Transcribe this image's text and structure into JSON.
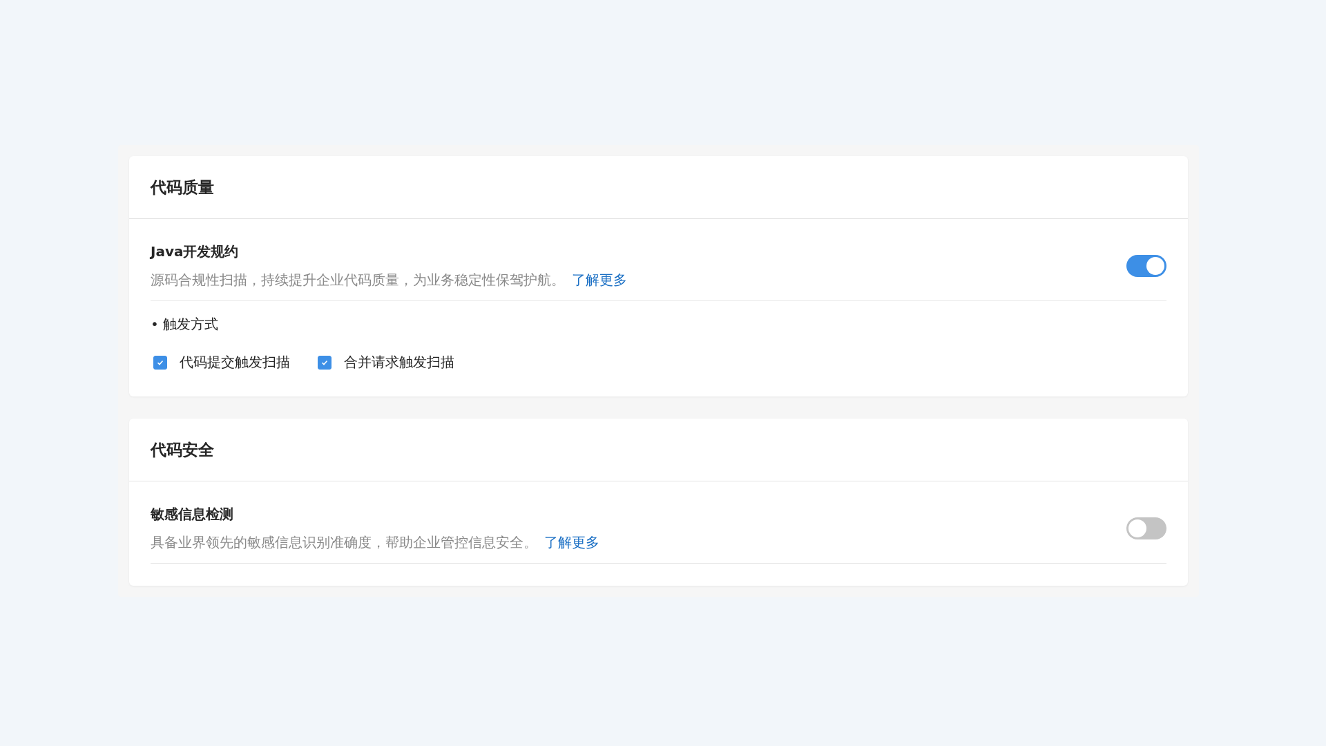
{
  "sections": [
    {
      "title": "代码质量",
      "items": [
        {
          "name": "Java开发规约",
          "description": "源码合规性扫描，持续提升企业代码质量，为业务稳定性保驾护航。",
          "link": "了解更多",
          "on": true,
          "trigger": {
            "label": "• 触发方式",
            "options": [
              {
                "label": "代码提交触发扫描",
                "checked": true
              },
              {
                "label": "合并请求触发扫描",
                "checked": true
              }
            ]
          }
        }
      ]
    },
    {
      "title": "代码安全",
      "items": [
        {
          "name": "敏感信息检测",
          "description": "具备业界领先的敏感信息识别准确度，帮助企业管控信息安全。",
          "link": "了解更多",
          "on": false
        }
      ]
    }
  ]
}
